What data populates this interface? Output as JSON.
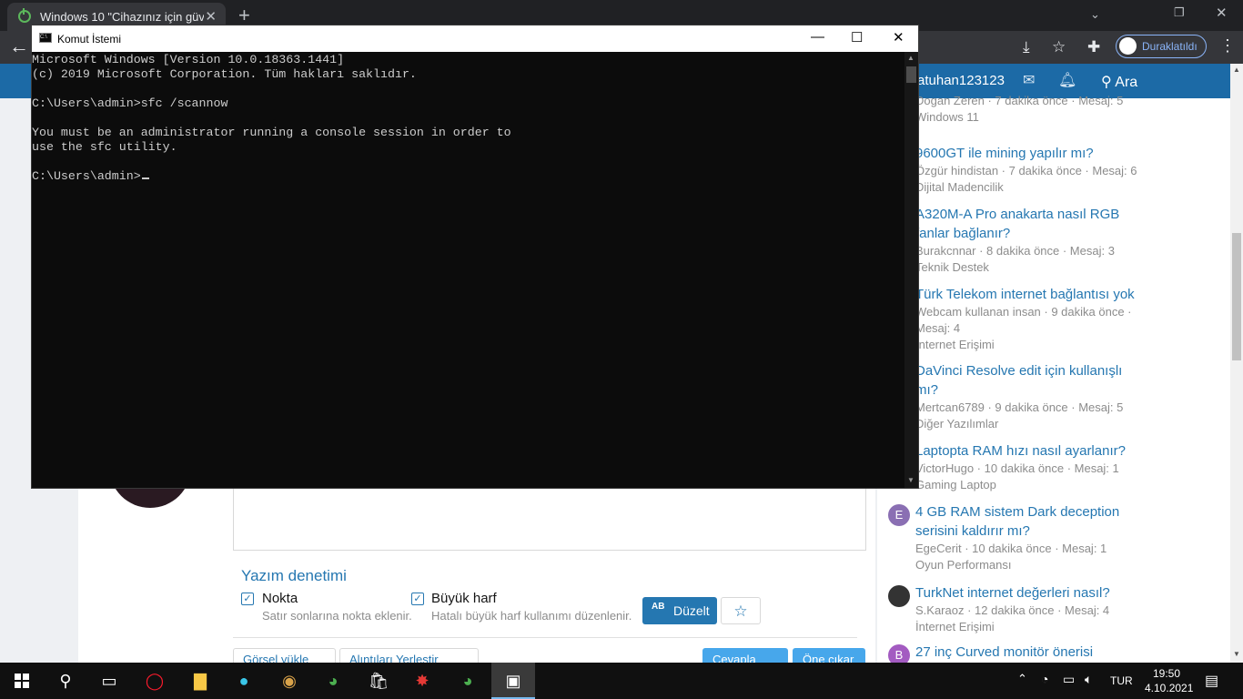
{
  "browser": {
    "tab_title": "Windows 10 \"Cihazınız için güven",
    "tab_close": "✕",
    "new_tab": "+",
    "window_controls": [
      "⌄",
      "—",
      "❐",
      "✕"
    ],
    "back": "←",
    "paused_label": "Duraklatıldı",
    "menu": "⋮"
  },
  "site": {
    "username": "atuhan123123",
    "search_label": "Ara",
    "threads": [
      {
        "title": "",
        "meta": "Dogan Zeren · 7 dakika önce · Mesaj: 5",
        "forum": "Windows 11"
      },
      {
        "title": "9600GT ile mining yapılır mı?",
        "meta": "Özgür hindistan · 7 dakika önce · Mesaj: 6",
        "forum": "Dijital Madencilik"
      },
      {
        "title": "A320M-A Pro anakarta nasıl RGB fanlar bağlanır?",
        "meta": "Burakcnnar · 8 dakika önce · Mesaj: 3",
        "forum": "Teknik Destek"
      },
      {
        "title": "Türk Telekom internet bağlantısı yok",
        "meta": "Webcam kullanan insan · 9 dakika önce · Mesaj: 4",
        "forum": "İnternet Erişimi"
      },
      {
        "title": "DaVinci Resolve edit için kullanışlı mı?",
        "meta": "Mertcan6789 · 9 dakika önce · Mesaj: 5",
        "forum": "Diğer Yazılımlar"
      },
      {
        "title": "Laptopta RAM hızı nasıl ayarlanır?",
        "meta": "VictorHugo · 10 dakika önce · Mesaj: 1",
        "forum": "Gaming Laptop"
      },
      {
        "title": "4 GB RAM sistem Dark deception serisini kaldırır mı?",
        "meta": "EgeCerit · 10 dakika önce · Mesaj: 1",
        "forum": "Oyun Performansı",
        "avatar_letter": "E",
        "avatar_color": "#8a6fb3"
      },
      {
        "title": "TurkNet internet değerleri nasıl?",
        "meta": "S.Karaoz · 12 dakika önce · Mesaj: 4",
        "forum": "İnternet Erişimi"
      },
      {
        "title": "27 inç Curved monitör önerisi",
        "meta": "",
        "forum": "",
        "avatar_letter": "B",
        "avatar_color": "#a35bc1"
      }
    ],
    "spell": {
      "title": "Yazım denetimi",
      "nokta_label": "Nokta",
      "nokta_desc": "Satır sonlarına nokta eklenir.",
      "buyuk_label": "Büyük harf",
      "buyuk_desc": "Hatalı büyük harf kullanımı düzenlenir.",
      "duzelt_icon": "AB",
      "duzelt_label": "Düzelt"
    },
    "bottom_buttons": [
      "Görsel yükle",
      "Alıntıları Yerleştir",
      "Cevapla",
      "Öne çıkar"
    ]
  },
  "console": {
    "title": "Komut İstemi",
    "line1": "Microsoft Windows [Version 10.0.18363.1441]",
    "line2": "(c) 2019 Microsoft Corporation. Tüm hakları saklıdır.",
    "line3": "",
    "line4": "C:\\Users\\admin>sfc /scannow",
    "line5": "",
    "line6": "You must be an administrator running a console session in order to",
    "line7": "use the sfc utility.",
    "line8": "",
    "prompt": "C:\\Users\\admin>",
    "minimize": "—",
    "maximize": "☐",
    "close": "✕"
  },
  "taskbar": {
    "language": "TUR",
    "time": "19:50",
    "date": "4.10.2021"
  }
}
